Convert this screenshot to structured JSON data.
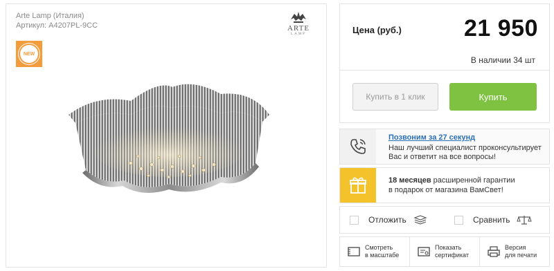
{
  "product": {
    "brand": "Arte Lamp (Италия)",
    "sku": "Артикул: A4207PL-9CC",
    "badge": "NEW",
    "logo_text": "ARTE",
    "logo_sub": "LAMP"
  },
  "price": {
    "label": "Цена (руб.)",
    "value": "21 950",
    "stock": "В наличии 34 шт"
  },
  "buttons": {
    "one_click": "Купить в 1 клик",
    "buy": "Купить"
  },
  "callback": {
    "link": "Позвоним за 27 секунд",
    "text": "Наш лучший специалист проконсультирует Вас и ответит на все вопросы!"
  },
  "warranty": {
    "bold": "18 месяцев",
    "text": " расширенной гарантии",
    "line2": "в подарок от магазина ВамСвет!"
  },
  "actions": {
    "defer": "Отложить",
    "compare": "Сравнить"
  },
  "tools": [
    {
      "line1": "Смотреть",
      "line2": "в масштабе"
    },
    {
      "line1": "Показать",
      "line2": "сертификат"
    },
    {
      "line1": "Версия",
      "line2": "для печати"
    }
  ],
  "colors": {
    "buy_green": "#7fc241",
    "badge_orange": "#f39c3c",
    "warranty_yellow": "#f4c22b",
    "link_blue": "#2a6fb5"
  }
}
